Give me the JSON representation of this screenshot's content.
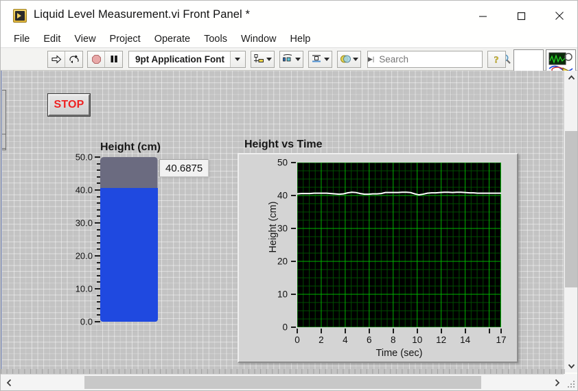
{
  "window": {
    "title": "Liquid Level Measurement.vi Front Panel *",
    "app_icon": "labview-vi-icon",
    "minimize_label": "Minimize",
    "maximize_label": "Maximize",
    "close_label": "Close"
  },
  "menu": {
    "items": [
      {
        "label": "File"
      },
      {
        "label": "Edit"
      },
      {
        "label": "View"
      },
      {
        "label": "Project"
      },
      {
        "label": "Operate"
      },
      {
        "label": "Tools"
      },
      {
        "label": "Window"
      },
      {
        "label": "Help"
      }
    ]
  },
  "toolbar": {
    "run_label": "Run",
    "run_continuously_label": "Run Continuously",
    "abort_label": "Abort Execution",
    "pause_label": "Pause",
    "font_selector_value": "9pt Application Font",
    "align_objects_label": "Align Objects",
    "distribute_objects_label": "Distribute Objects",
    "resize_objects_label": "Resize Objects",
    "reorder_label": "Reorder",
    "search_placeholder": "Search",
    "search_value": "",
    "help_label": "Show Context Help",
    "vi_icon_number": "1"
  },
  "panel": {
    "stop_button_label": "STOP",
    "tank": {
      "label": "Height (cm)",
      "value": 40.6875,
      "display_value": "40.6875",
      "min": 0,
      "max": 50,
      "fill_color": "#1f49e0",
      "empty_color": "#6b6b80",
      "tick_labels": [
        "50.0",
        "40.0",
        "30.0",
        "20.0",
        "10.0",
        "0.0"
      ],
      "tick_values": [
        50,
        40,
        30,
        20,
        10,
        0
      ]
    }
  },
  "chart_data": {
    "type": "line",
    "title": "Height vs Time",
    "xlabel": "Time (sec)",
    "ylabel": "Height (cm)",
    "xlim": [
      0,
      17
    ],
    "ylim": [
      0,
      50
    ],
    "xticks": [
      0,
      2,
      4,
      6,
      8,
      10,
      12,
      14,
      17
    ],
    "xtick_labels": [
      "0",
      "2",
      "4",
      "6",
      "8",
      "10",
      "12",
      "14",
      "17"
    ],
    "yticks": [
      0,
      10,
      20,
      30,
      40,
      50
    ],
    "ytick_labels": [
      "0",
      "10",
      "20",
      "30",
      "40",
      "50"
    ],
    "grid": true,
    "grid_color": "#00b400",
    "minor_grid_color": "#004d00",
    "plot_bg": "#000000",
    "legend": null,
    "series": [
      {
        "name": "Height",
        "color": "#ffffff",
        "x": [
          0,
          0.35,
          0.7,
          1.05,
          1.4,
          1.75,
          2.1,
          2.45,
          2.8,
          3.15,
          3.5,
          3.85,
          4.2,
          4.55,
          4.9,
          5.25,
          5.6,
          5.95,
          6.3,
          6.65,
          7.0,
          7.35,
          7.7,
          8.05,
          8.4,
          8.75,
          9.1,
          9.45,
          9.8,
          10.15,
          10.5,
          10.85,
          11.2,
          11.55,
          11.9,
          12.25,
          12.6,
          12.95,
          13.3,
          13.65,
          14.0,
          14.35,
          14.7,
          15.05,
          15.4,
          15.75,
          16.1,
          16.45,
          16.8,
          17.0
        ],
        "y": [
          40.5,
          40.6,
          40.6,
          40.6,
          40.7,
          40.7,
          40.7,
          40.7,
          40.6,
          40.5,
          40.4,
          40.5,
          40.8,
          41.0,
          40.9,
          40.6,
          40.4,
          40.4,
          40.5,
          40.5,
          40.6,
          40.9,
          40.9,
          40.9,
          40.9,
          41.0,
          41.0,
          40.9,
          40.5,
          40.2,
          40.4,
          40.7,
          40.8,
          40.8,
          40.9,
          41.0,
          41.0,
          40.9,
          41.0,
          41.0,
          40.9,
          40.8,
          40.8,
          40.7,
          40.7,
          40.7,
          40.7,
          40.7,
          40.7,
          40.7
        ]
      }
    ]
  },
  "scrollbars": {
    "vertical_up_label": "Scroll Up",
    "vertical_down_label": "Scroll Down",
    "horizontal_left_label": "Scroll Left",
    "horizontal_right_label": "Scroll Right"
  }
}
